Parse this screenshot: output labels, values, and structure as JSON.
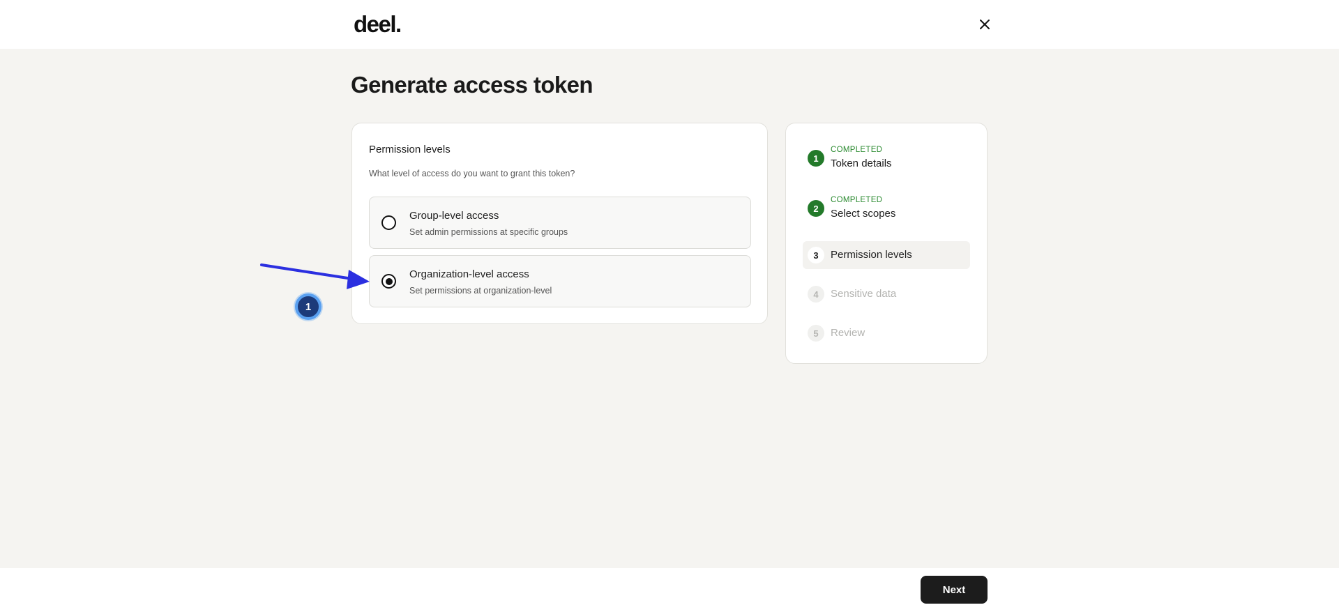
{
  "header": {
    "logo": "deel.",
    "close_icon": "close-icon"
  },
  "page": {
    "title": "Generate access token"
  },
  "permission_card": {
    "title": "Permission levels",
    "description": "What level of access do you want to grant this token?",
    "options": [
      {
        "title": "Group-level access",
        "subtitle": "Set admin permissions at specific groups",
        "selected": false
      },
      {
        "title": "Organization-level access",
        "subtitle": "Set permissions at organization-level",
        "selected": true
      }
    ]
  },
  "stepper": {
    "steps": [
      {
        "number": "1",
        "status": "COMPLETED",
        "label": "Token details",
        "state": "completed"
      },
      {
        "number": "2",
        "status": "COMPLETED",
        "label": "Select scopes",
        "state": "completed"
      },
      {
        "number": "3",
        "label": "Permission levels",
        "state": "active"
      },
      {
        "number": "4",
        "label": "Sensitive data",
        "state": "pending"
      },
      {
        "number": "5",
        "label": "Review",
        "state": "pending"
      }
    ]
  },
  "footer": {
    "next_label": "Next"
  },
  "annotation": {
    "badge_number": "1",
    "arrow_color": "#2b2fe0"
  },
  "colors": {
    "background": "#f5f4f1",
    "completed_green": "#237a2a",
    "primary_button": "#1c1c1c"
  }
}
